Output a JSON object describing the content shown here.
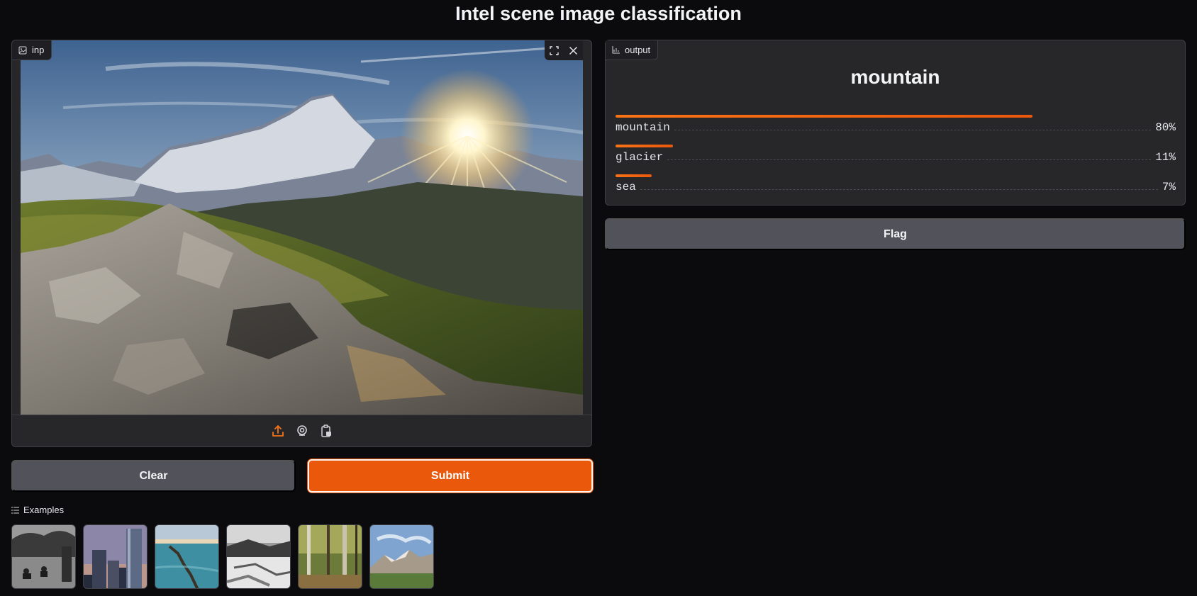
{
  "page": {
    "title": "Intel scene image classification"
  },
  "input": {
    "label": "inp",
    "icons": {
      "label": "image-icon",
      "fullscreen": "fullscreen-icon",
      "clear": "close-icon"
    },
    "sources": [
      "upload-icon",
      "webcam-icon",
      "clipboard-icon"
    ]
  },
  "buttons": {
    "clear": "Clear",
    "submit": "Submit",
    "flag": "Flag"
  },
  "examples": {
    "label": "Examples",
    "items": [
      "street-thumbnail",
      "buildings-thumbnail",
      "sea-thumbnail",
      "glacier-thumbnail",
      "forest-thumbnail",
      "mountain-thumbnail"
    ]
  },
  "output": {
    "label": "output",
    "top_label": "mountain",
    "confidences": [
      {
        "label": "mountain",
        "percent": "80%",
        "value": 0.8
      },
      {
        "label": "glacier",
        "percent": "11%",
        "value": 0.11
      },
      {
        "label": "sea",
        "percent": "7%",
        "value": 0.07
      }
    ]
  },
  "colors": {
    "accent": "#ea580c",
    "panel": "#27272a",
    "background": "#0b0b0e",
    "secondary_button": "#52525b"
  }
}
